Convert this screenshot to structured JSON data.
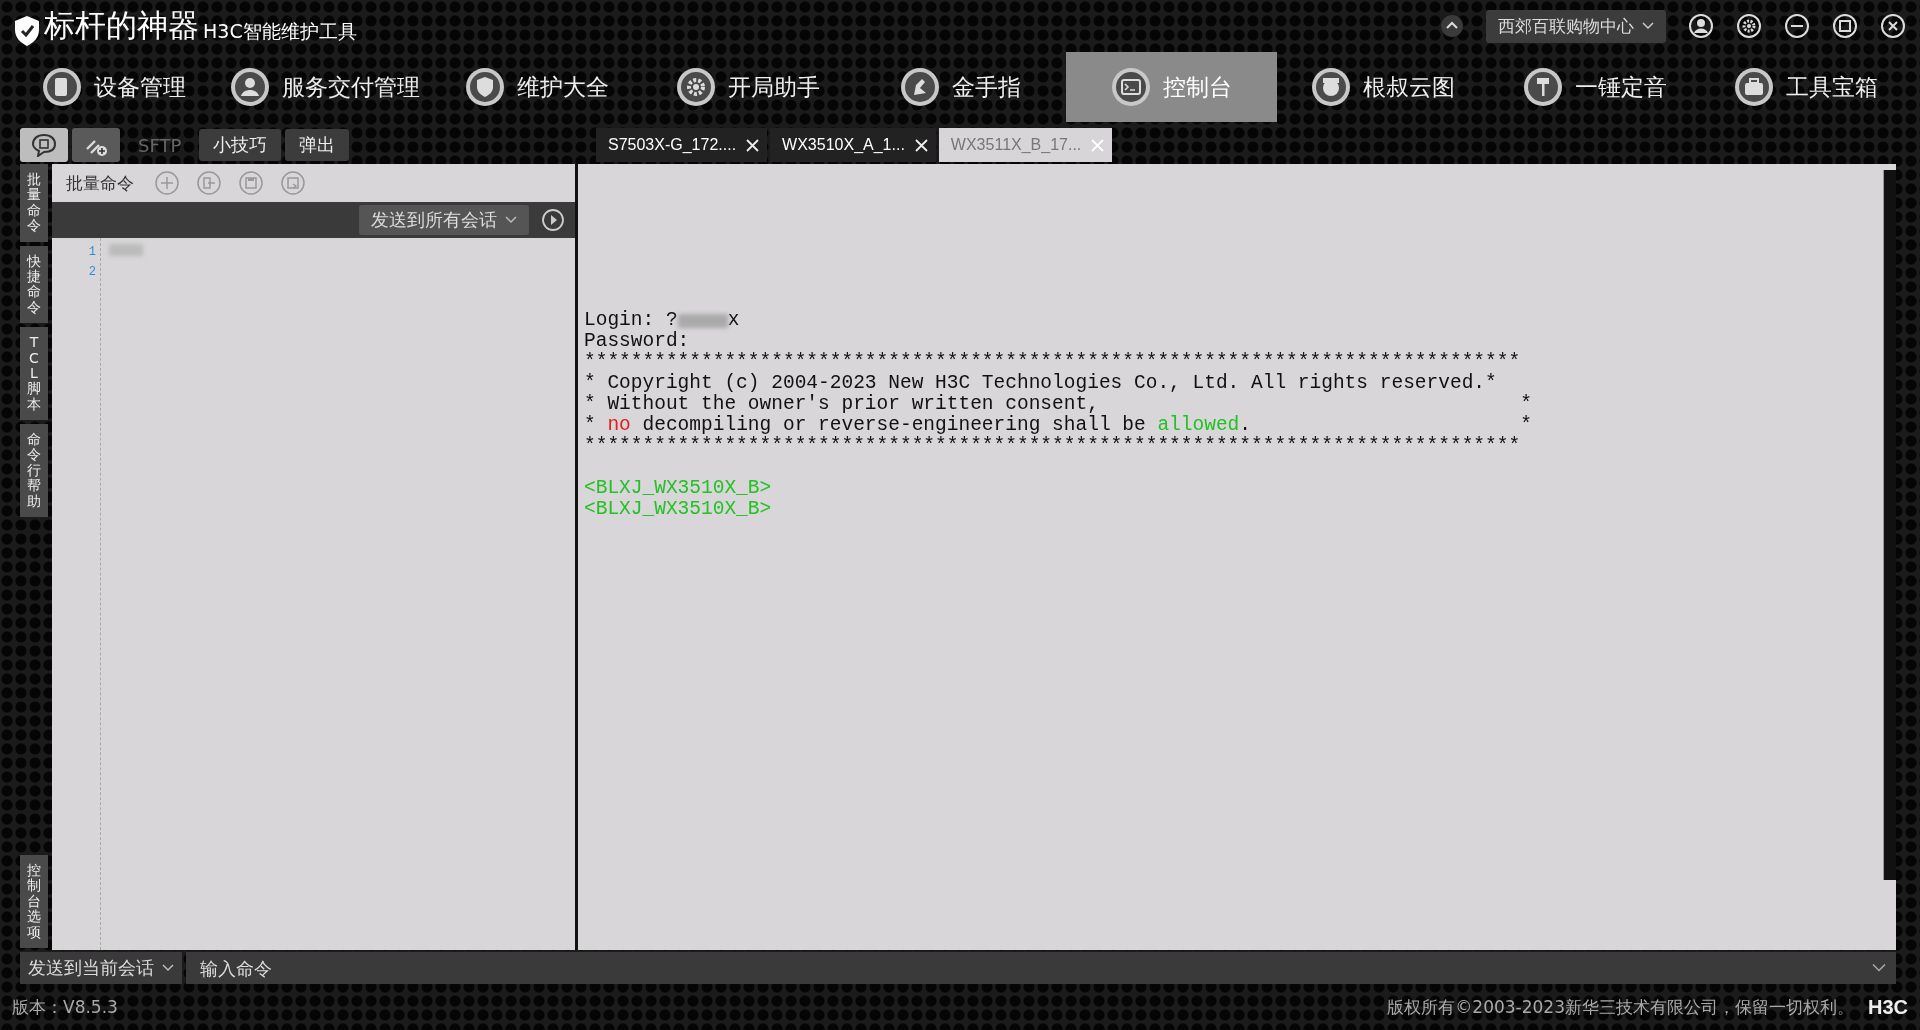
{
  "title": {
    "name": "标杆的神器",
    "subtitle": "H3C智能维护工具"
  },
  "topbar": {
    "location": "西郊百联购物中心"
  },
  "nav": [
    {
      "label": "设备管理",
      "selected": false
    },
    {
      "label": "服务交付管理",
      "selected": false
    },
    {
      "label": "维护大全",
      "selected": false
    },
    {
      "label": "开局助手",
      "selected": false
    },
    {
      "label": "金手指",
      "selected": false
    },
    {
      "label": "控制台",
      "selected": true
    },
    {
      "label": "根叔云图",
      "selected": false
    },
    {
      "label": "一锤定音",
      "selected": false
    },
    {
      "label": "工具宝箱",
      "selected": false
    }
  ],
  "toolbar": [
    {
      "label": "SFTP",
      "disabled": true
    },
    {
      "label": "小技巧",
      "disabled": false
    },
    {
      "label": "弹出",
      "disabled": false
    }
  ],
  "session_tabs": [
    {
      "label": "S7503X-G_172....",
      "selected": false
    },
    {
      "label": "WX3510X_A_1...",
      "selected": false
    },
    {
      "label": "WX3511X_B_17...",
      "selected": true
    }
  ],
  "side_tabs": [
    "批量命令",
    "快捷命令",
    "TCL 脚本",
    "命令行帮助"
  ],
  "side_bottom_tab": "控制台选项",
  "batch": {
    "title": "批量命令",
    "send_target": "发送到所有会话",
    "line_numbers": [
      "1",
      "2"
    ]
  },
  "terminal": {
    "output": [
      [
        {
          "text": "Login: "
        },
        {
          "text": "?"
        },
        {
          "text": "x"
        }
      ],
      [
        {
          "text": "Password:"
        }
      ],
      [
        {
          "text": "********************************************************************************"
        }
      ],
      [
        {
          "text": "* Copyright (c) 2004-2023 New H3C Technologies Co., Ltd. All rights reserved.*"
        }
      ],
      [
        {
          "text": "* Without the owner's prior written consent,                                    *"
        }
      ],
      [
        {
          "text": "* "
        },
        {
          "text": "no",
          "color": "#e0201e"
        },
        {
          "text": " decompiling or reverse-engineering shall be "
        },
        {
          "text": "allowed",
          "color": "#24c124"
        },
        {
          "text": ".                       *"
        }
      ],
      [
        {
          "text": "********************************************************************************"
        }
      ]
    ],
    "prompts": [
      "<BLXJ_WX3510X_B>",
      "<BLXJ_WX3510X_B>"
    ]
  },
  "command_bar": {
    "send_target": "发送到当前会话",
    "placeholder": "输入命令"
  },
  "status_bar": {
    "version": "版本：V8.5.3",
    "copyright": "版权所有©2003-2023新华三技术有限公司，保留一切权利。",
    "logo": "H3C"
  }
}
